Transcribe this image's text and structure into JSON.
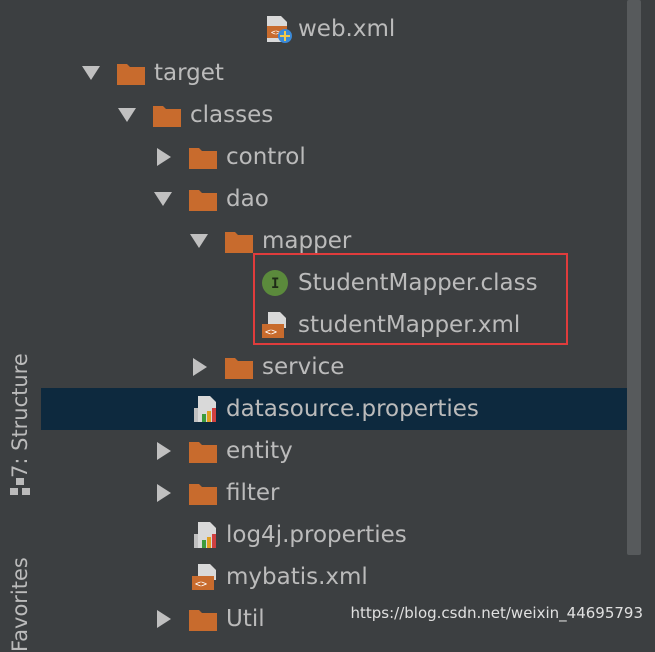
{
  "sidebar": {
    "structure_label": "7: Structure",
    "favorites_label": "Favorites"
  },
  "tree": {
    "header_file": {
      "label": "web.xml",
      "icon": "web-xml-icon"
    },
    "items": [
      {
        "label": "target",
        "icon": "folder-icon",
        "expanded": true
      },
      {
        "label": "classes",
        "icon": "folder-icon",
        "expanded": true
      },
      {
        "label": "control",
        "icon": "folder-icon",
        "expanded": false
      },
      {
        "label": "dao",
        "icon": "folder-icon",
        "expanded": true
      },
      {
        "label": "mapper",
        "icon": "folder-icon",
        "expanded": true
      },
      {
        "label": "StudentMapper.class",
        "icon": "interface-class-icon"
      },
      {
        "label": "studentMapper.xml",
        "icon": "xml-file-icon"
      },
      {
        "label": "service",
        "icon": "folder-icon",
        "expanded": false
      },
      {
        "label": "datasource.properties",
        "icon": "properties-file-icon",
        "selected": true
      },
      {
        "label": "entity",
        "icon": "folder-icon",
        "expanded": false
      },
      {
        "label": "filter",
        "icon": "folder-icon",
        "expanded": false
      },
      {
        "label": "log4j.properties",
        "icon": "properties-file-icon"
      },
      {
        "label": "mybatis.xml",
        "icon": "xml-file-icon"
      },
      {
        "label": "Util",
        "icon": "folder-icon",
        "expanded": false
      }
    ]
  },
  "colors": {
    "background": "#3c3f41",
    "selection": "#0d293e",
    "folder": "#c86b2d",
    "highlight_box": "#e03c3c",
    "interface_badge": "#5b8a3c"
  },
  "watermark": "https://blog.csdn.net/weixin_44695793"
}
